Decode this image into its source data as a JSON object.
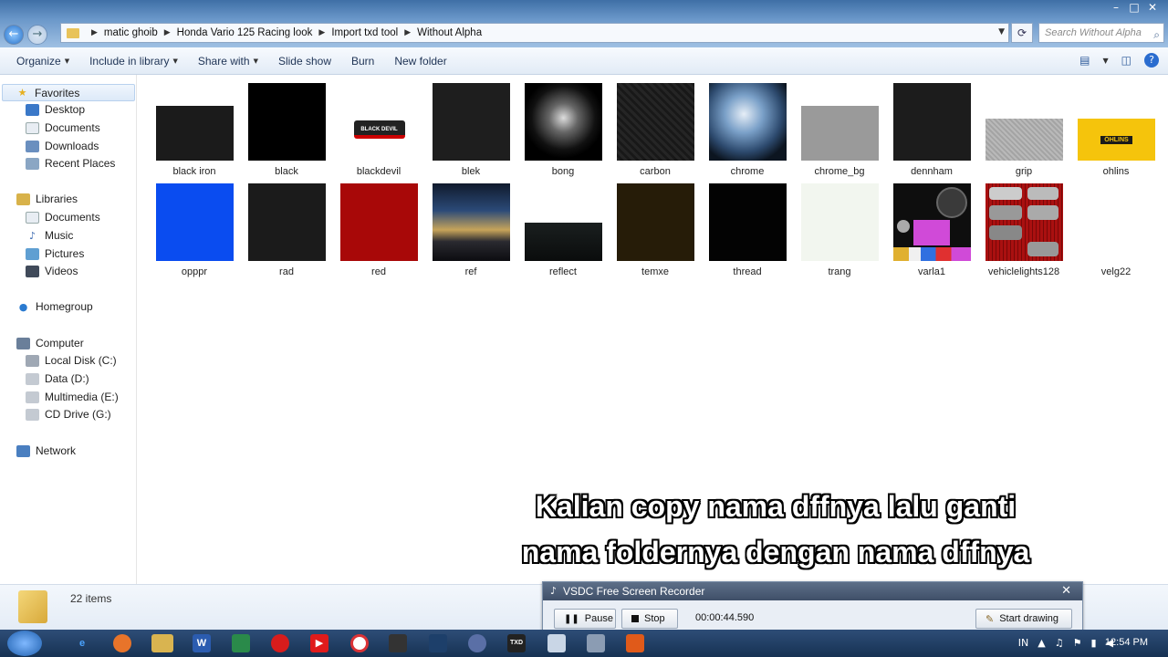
{
  "window": {
    "controls": [
      "–",
      "□",
      "✕"
    ],
    "breadcrumb": [
      "matic ghoib",
      "Honda Vario 125 Racing look",
      "Import txd tool",
      "Without Alpha"
    ],
    "search_placeholder": "Search Without Alpha"
  },
  "toolbar": {
    "organize": "Organize",
    "include": "Include in library",
    "share": "Share with",
    "slideshow": "Slide show",
    "burn": "Burn",
    "new_folder": "New folder"
  },
  "nav": {
    "favorites": "Favorites",
    "desktop": "Desktop",
    "documents": "Documents",
    "downloads": "Downloads",
    "recent": "Recent Places",
    "libraries": "Libraries",
    "lib_documents": "Documents",
    "music": "Music",
    "pictures": "Pictures",
    "videos": "Videos",
    "homegroup": "Homegroup",
    "computer": "Computer",
    "local_disk": "Local Disk (C:)",
    "data_d": "Data (D:)",
    "multimedia": "Multimedia (E:)",
    "cd_drive": "CD Drive (G:)",
    "network": "Network"
  },
  "files": [
    {
      "name": "black iron"
    },
    {
      "name": "black"
    },
    {
      "name": "blackdevil",
      "logo_text": "BLACK DEVIL"
    },
    {
      "name": "blek"
    },
    {
      "name": "bong"
    },
    {
      "name": "carbon"
    },
    {
      "name": "chrome"
    },
    {
      "name": "chrome_bg"
    },
    {
      "name": "dennham"
    },
    {
      "name": "grip"
    },
    {
      "name": "ohlins",
      "logo_text": "ÖHLINS"
    },
    {
      "name": "opppr"
    },
    {
      "name": "rad"
    },
    {
      "name": "red"
    },
    {
      "name": "ref"
    },
    {
      "name": "reflect"
    },
    {
      "name": "temxe"
    },
    {
      "name": "thread"
    },
    {
      "name": "trang"
    },
    {
      "name": "varla1"
    },
    {
      "name": "vehiclelights128"
    },
    {
      "name": "velg22"
    }
  ],
  "status": {
    "count": "22 items"
  },
  "caption": {
    "line1": "Kalian copy nama dffnya lalu ganti",
    "line2": "nama foldernya dengan nama dffnya"
  },
  "recorder": {
    "title": "VSDC Free Screen Recorder",
    "pause": "Pause",
    "stop": "Stop",
    "time": "00:00:44.590",
    "draw": "Start drawing"
  },
  "taskbar": {
    "tray_lang": "IN",
    "clock": "12:54 PM"
  }
}
